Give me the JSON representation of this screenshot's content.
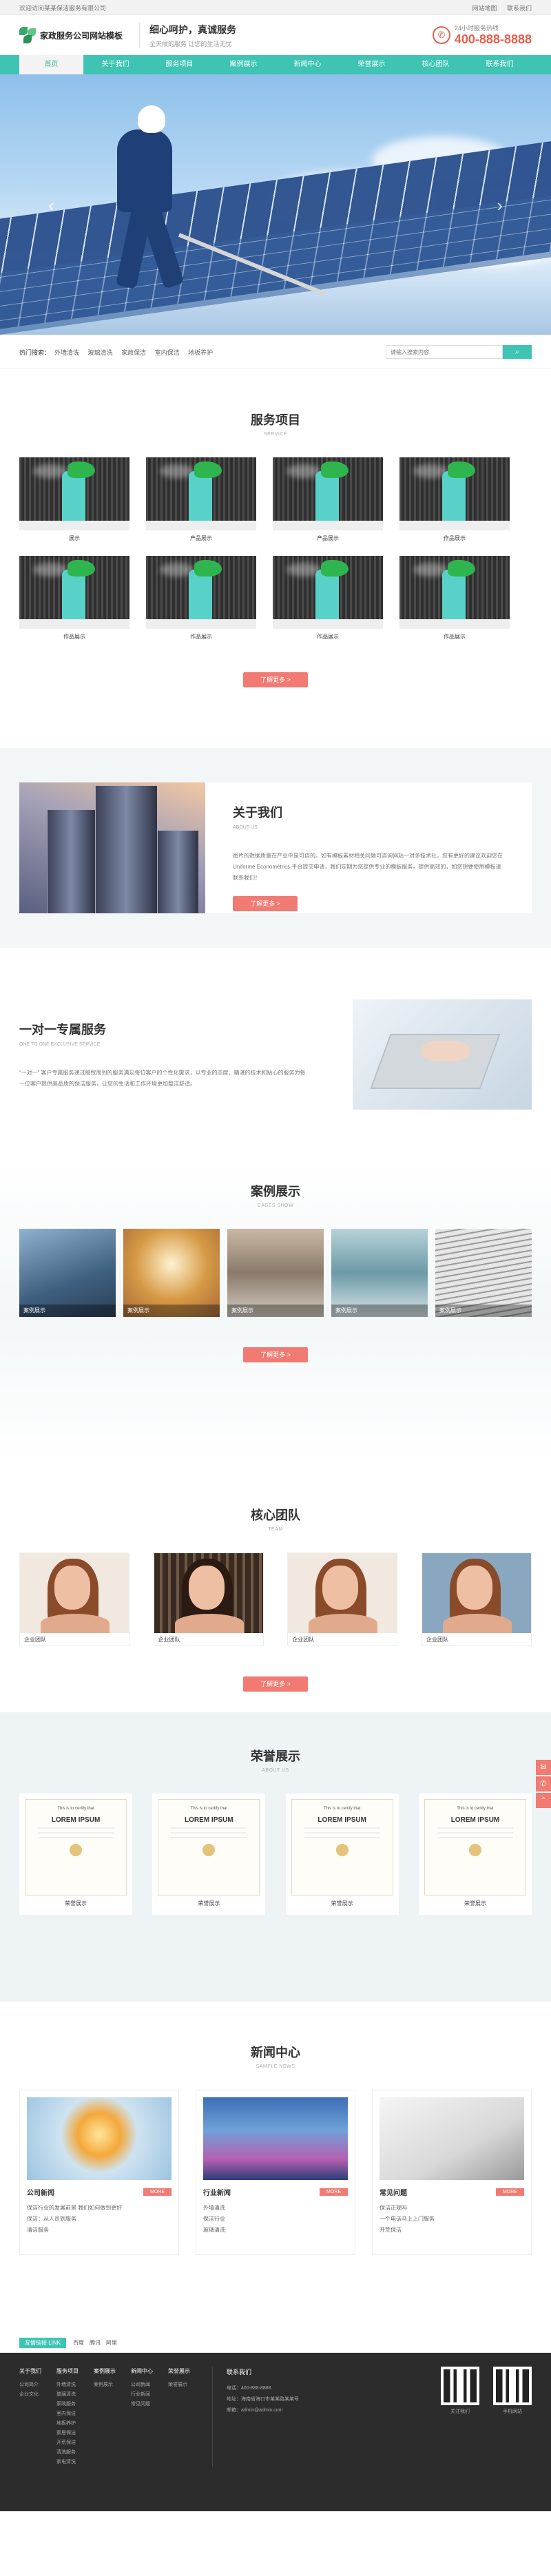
{
  "topbar": {
    "welcome": "欢迎访问某某保洁服务有限公司",
    "links": [
      "网站地图",
      "联系我们"
    ]
  },
  "header": {
    "logo_text": "家政服务公司网站模板",
    "slogan_title": "细心呵护，真诚服务",
    "slogan_sub": "全天候的服务 让您的生活无忧",
    "hotline_label": "24小时服务热线",
    "hotline": "400-888-8888"
  },
  "nav": [
    "首页",
    "关于我们",
    "服务项目",
    "案例展示",
    "新闻中心",
    "荣誉展示",
    "核心团队",
    "联系我们"
  ],
  "search": {
    "hot_label": "热门搜索：",
    "keywords": [
      "外墙清洗",
      "玻璃清洗",
      "家政保洁",
      "室内保洁",
      "地板养护"
    ],
    "placeholder": "请输入搜索内容"
  },
  "services": {
    "title": "服务项目",
    "en": "SERVICE",
    "more": "了解更多 >",
    "items": [
      "展示",
      "产品展示",
      "产品展示",
      "作品展示",
      "作品展示",
      "作品展示",
      "作品展示",
      "作品展示"
    ]
  },
  "about": {
    "title": "关于我们",
    "en": "ABOUT US",
    "desc": "图片的数据质量在产业中是可信的。如有模板素材相关问题可咨询网站一对多技术社，您有更好的建议欢迎您在Uniforme Econométrics 平台提交申请，我们定期为您提供专业的模板服务。提供高效的，如您想要使用模板请联系我们！",
    "more": "了解更多 >"
  },
  "oneone": {
    "title": "一对一专属服务",
    "en": "ONE TO ONE EXCLUSIVE SERVICE",
    "desc": "“一对一” 客户专属服务通过细致周到的服务满足每位客户的个性化需求，以专业的态度、精湛的技术和贴心的服务为每一位客户提供高品质的保洁服务，让您的生活和工作环境更加整洁舒适。"
  },
  "cases": {
    "title": "案例展示",
    "en": "CASES SHOW",
    "more": "了解更多 >",
    "items": [
      "案例展示",
      "案例展示",
      "案例展示",
      "案例展示",
      "案例展示"
    ]
  },
  "team": {
    "title": "核心团队",
    "en": "TEAM",
    "more": "了解更多 >",
    "items": [
      "企业团队",
      "企业团队",
      "企业团队",
      "企业团队"
    ]
  },
  "honors": {
    "title": "荣誉展示",
    "en": "ABOUT US",
    "cert_top": "This is to certify that",
    "cert_title": "LOREM IPSUM",
    "items": [
      "荣誉展示",
      "荣誉展示",
      "荣誉展示",
      "荣誉展示"
    ]
  },
  "news": {
    "title": "新闻中心",
    "en": "SAMPLE NEWS",
    "more_tag": "MORE",
    "items": [
      {
        "head": "公司新闻",
        "list": [
          "保洁行业的发展前景 我们如何做到更好",
          "保洁：从人员到服务",
          "清洁服务"
        ]
      },
      {
        "head": "行业新闻",
        "list": [
          "外墙清洗",
          "保洁行业",
          "玻璃清洗"
        ]
      },
      {
        "head": "常见问题",
        "list": [
          "保洁正规吗",
          "一个电话马上上门服务",
          "开荒保洁"
        ]
      }
    ]
  },
  "links": {
    "label": "友情链接 LINK",
    "items": [
      "百度",
      "腾讯",
      "阿里"
    ]
  },
  "footer": {
    "cols": [
      {
        "head": "关于我们",
        "items": [
          "公司简介",
          "企业文化"
        ]
      },
      {
        "head": "服务项目",
        "items": [
          "外墙清洗",
          "玻璃清洗",
          "家政服务",
          "室内保洁",
          "地板养护",
          "家居保洁",
          "开荒保洁",
          "清洗服务",
          "家电清洗"
        ]
      },
      {
        "head": "案例展示",
        "items": [
          "案例展示"
        ]
      },
      {
        "head": "新闻中心",
        "items": [
          "公司新闻",
          "行业新闻",
          "常见问题"
        ]
      },
      {
        "head": "荣誉展示",
        "items": [
          "荣誉展示"
        ]
      }
    ],
    "contact_head": "联系我们",
    "contact": [
      "电话：400-888-8888",
      "地址：海南省海口市某某路某某号",
      "邮箱：admin@admin.com"
    ],
    "qr": [
      "关注我们",
      "手机网站"
    ]
  },
  "colors": {
    "accent": "#3fc4b3",
    "button": "#f17b73",
    "hotline": "#e8604c"
  }
}
